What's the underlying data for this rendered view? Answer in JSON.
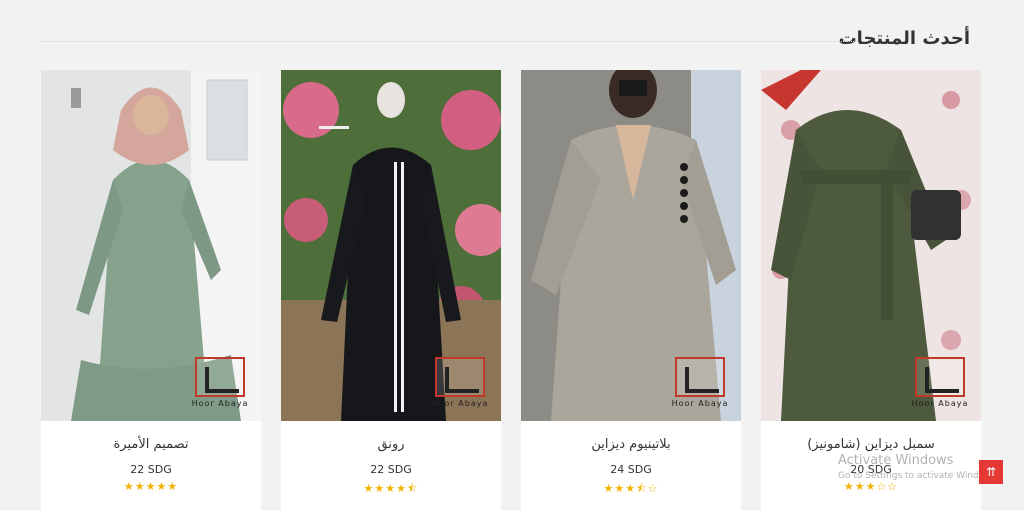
{
  "section": {
    "title": "أحدث المنتجات"
  },
  "products": [
    {
      "name": "تصميم الأميرة",
      "price": "22 SDG",
      "rating": 5,
      "brand": "Hoor Abaya"
    },
    {
      "name": "رونق",
      "price": "22 SDG",
      "rating": 4.5,
      "brand": "Hoor Abaya"
    },
    {
      "name": "بلاتينيوم ديزاين",
      "price": "24 SDG",
      "rating": 3.5,
      "brand": "Hoor Abaya"
    },
    {
      "name": "سمبل ديزاين (شامونيز)",
      "price": "20 SDG",
      "rating": 3,
      "brand": "Hoor Abaya"
    }
  ],
  "watermark": {
    "line1": "Activate Windows",
    "line2": "Go to Settings to activate Windows."
  },
  "icons": {
    "back_to_top": "double-chevron-up-icon",
    "star": "star-icon"
  },
  "colors": {
    "accent": "#e53935",
    "star": "#f0b400"
  }
}
